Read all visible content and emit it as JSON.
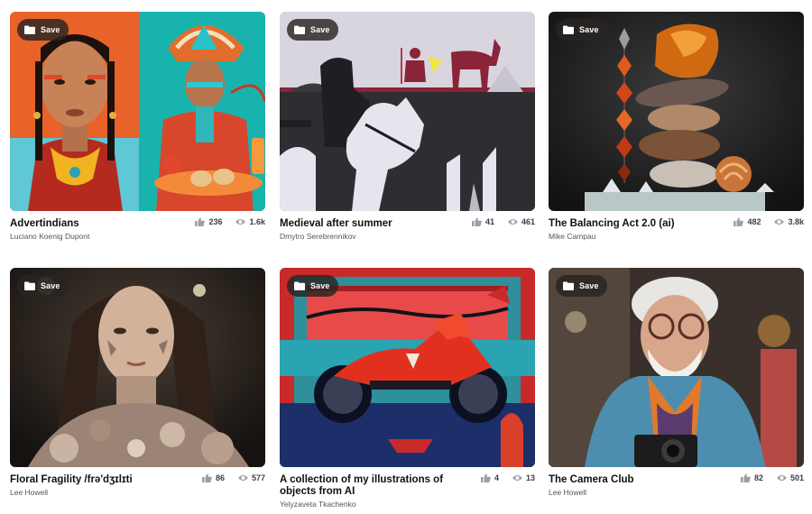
{
  "save_label": "Save",
  "cards": [
    {
      "title": "Advertindians",
      "title_line2": "",
      "author": "Luciano Koenig Dupont",
      "likes": "236",
      "views": "1.6k"
    },
    {
      "title": "Medieval after summer",
      "title_line2": "",
      "author": "Dmytro Serebrennikov",
      "likes": "41",
      "views": "461"
    },
    {
      "title": "The Balancing Act 2.0 (ai)",
      "title_line2": "",
      "author": "Mike Campau",
      "likes": "482",
      "views": "3.8k"
    },
    {
      "title": "Floral Fragility /frə'dʒɪlɪti",
      "title_line2": "",
      "author": "Lee Howell",
      "likes": "86",
      "views": "577"
    },
    {
      "title": "A collection of my illustrations of",
      "title_line2": "objects from AI",
      "author": "Yelyzaveta Tkachenko",
      "likes": "4",
      "views": "13"
    },
    {
      "title": "The Camera Club",
      "title_line2": "",
      "author": "Lee Howell",
      "likes": "82",
      "views": "501"
    }
  ],
  "icons": {
    "save": "folder-icon",
    "likes": "thumbs-up-icon",
    "views": "eye-icon"
  },
  "colors": {
    "save_bg": "#2a2522",
    "title": "#111111",
    "author": "#555555"
  }
}
